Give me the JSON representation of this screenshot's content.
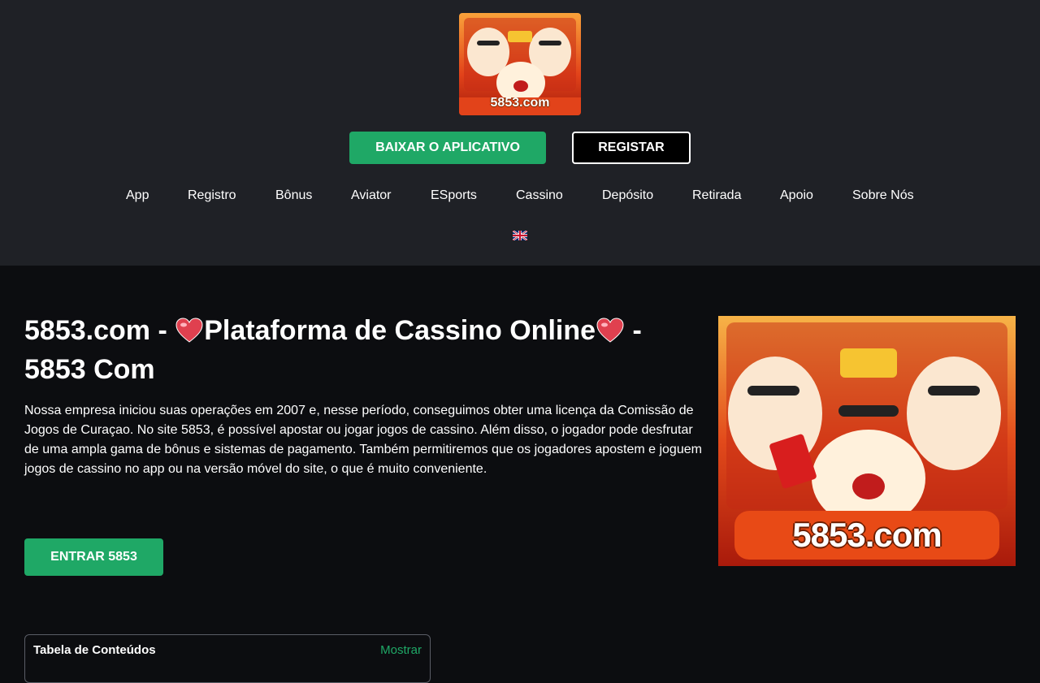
{
  "header": {
    "logo_text": "5853.com",
    "download_button": "BAIXAR O APLICATIVO",
    "register_button": "REGISTAR",
    "nav": [
      "App",
      "Registro",
      "Bônus",
      "Aviator",
      "ESports",
      "Cassino",
      "Depósito",
      "Retirada",
      "Apoio",
      "Sobre Nós"
    ],
    "language_icon": "uk-flag-icon"
  },
  "main": {
    "title_part1": "5853.com - ",
    "title_part2": "Plataforma de Cassino Online",
    "title_part3": " - 5853 Com",
    "intro": "Nossa empresa iniciou suas operações em 2007 e, nesse período, conseguimos obter uma licença da Comissão de Jogos de Curaçao. No site 5853, é possível apostar ou jogar jogos de cassino. Além disso, o jogador pode desfrutar de uma ampla gama de bônus e sistemas de pagamento. Também permitiremos que os jogadores apostem e joguem jogos de cassino no app ou na versão móvel do site, o que é muito conveniente.",
    "enter_button": "ENTRAR 5853",
    "hero_image_text": "5853.com"
  },
  "toc": {
    "title": "Tabela de Conteúdos",
    "toggle": "Mostrar"
  },
  "colors": {
    "accent_green": "#1fa866",
    "header_bg": "#1f2126",
    "body_bg": "#0c0d10",
    "heart": "#e0404f"
  }
}
